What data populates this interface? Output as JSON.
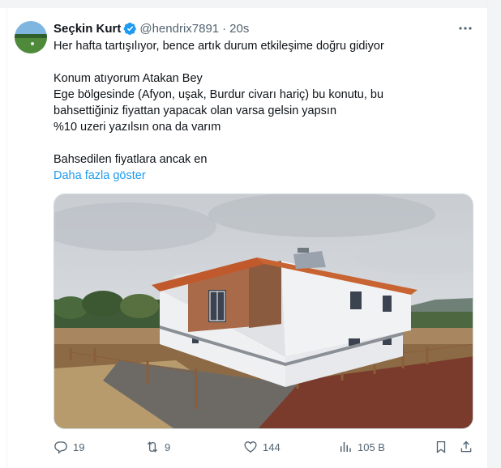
{
  "tweet": {
    "author_name": "Seçkin Kurt",
    "handle": "@hendrix7891",
    "separator": "·",
    "time": "20s",
    "verified": true,
    "lines": [
      "Her hafta tartışılıyor, bence artık durum etkileşime doğru gidiyor",
      "",
      "Konum atıyorum Atakan Bey",
      "Ege bölgesinde (Afyon, uşak, Burdur civarı hariç)  bu konutu, bu",
      "bahsettiğiniz fiyattan yapacak olan varsa gelsin yapsın",
      "%10 uzeri yazılsın ona da varım",
      "",
      "Bahsedilen fiyatlara ancak en"
    ],
    "show_more": "Daha fazla göster"
  },
  "actions": {
    "replies": "19",
    "reposts": "9",
    "likes": "144",
    "views": "105 B"
  },
  "icons": {
    "verified": "verified-badge-icon",
    "more": "more-icon",
    "reply": "reply-icon",
    "repost": "repost-icon",
    "like": "heart-icon",
    "views": "analytics-icon",
    "bookmark": "bookmark-icon",
    "share": "share-icon"
  },
  "colors": {
    "accent": "#1d9bf0",
    "text": "#0f1419",
    "muted": "#536471"
  }
}
